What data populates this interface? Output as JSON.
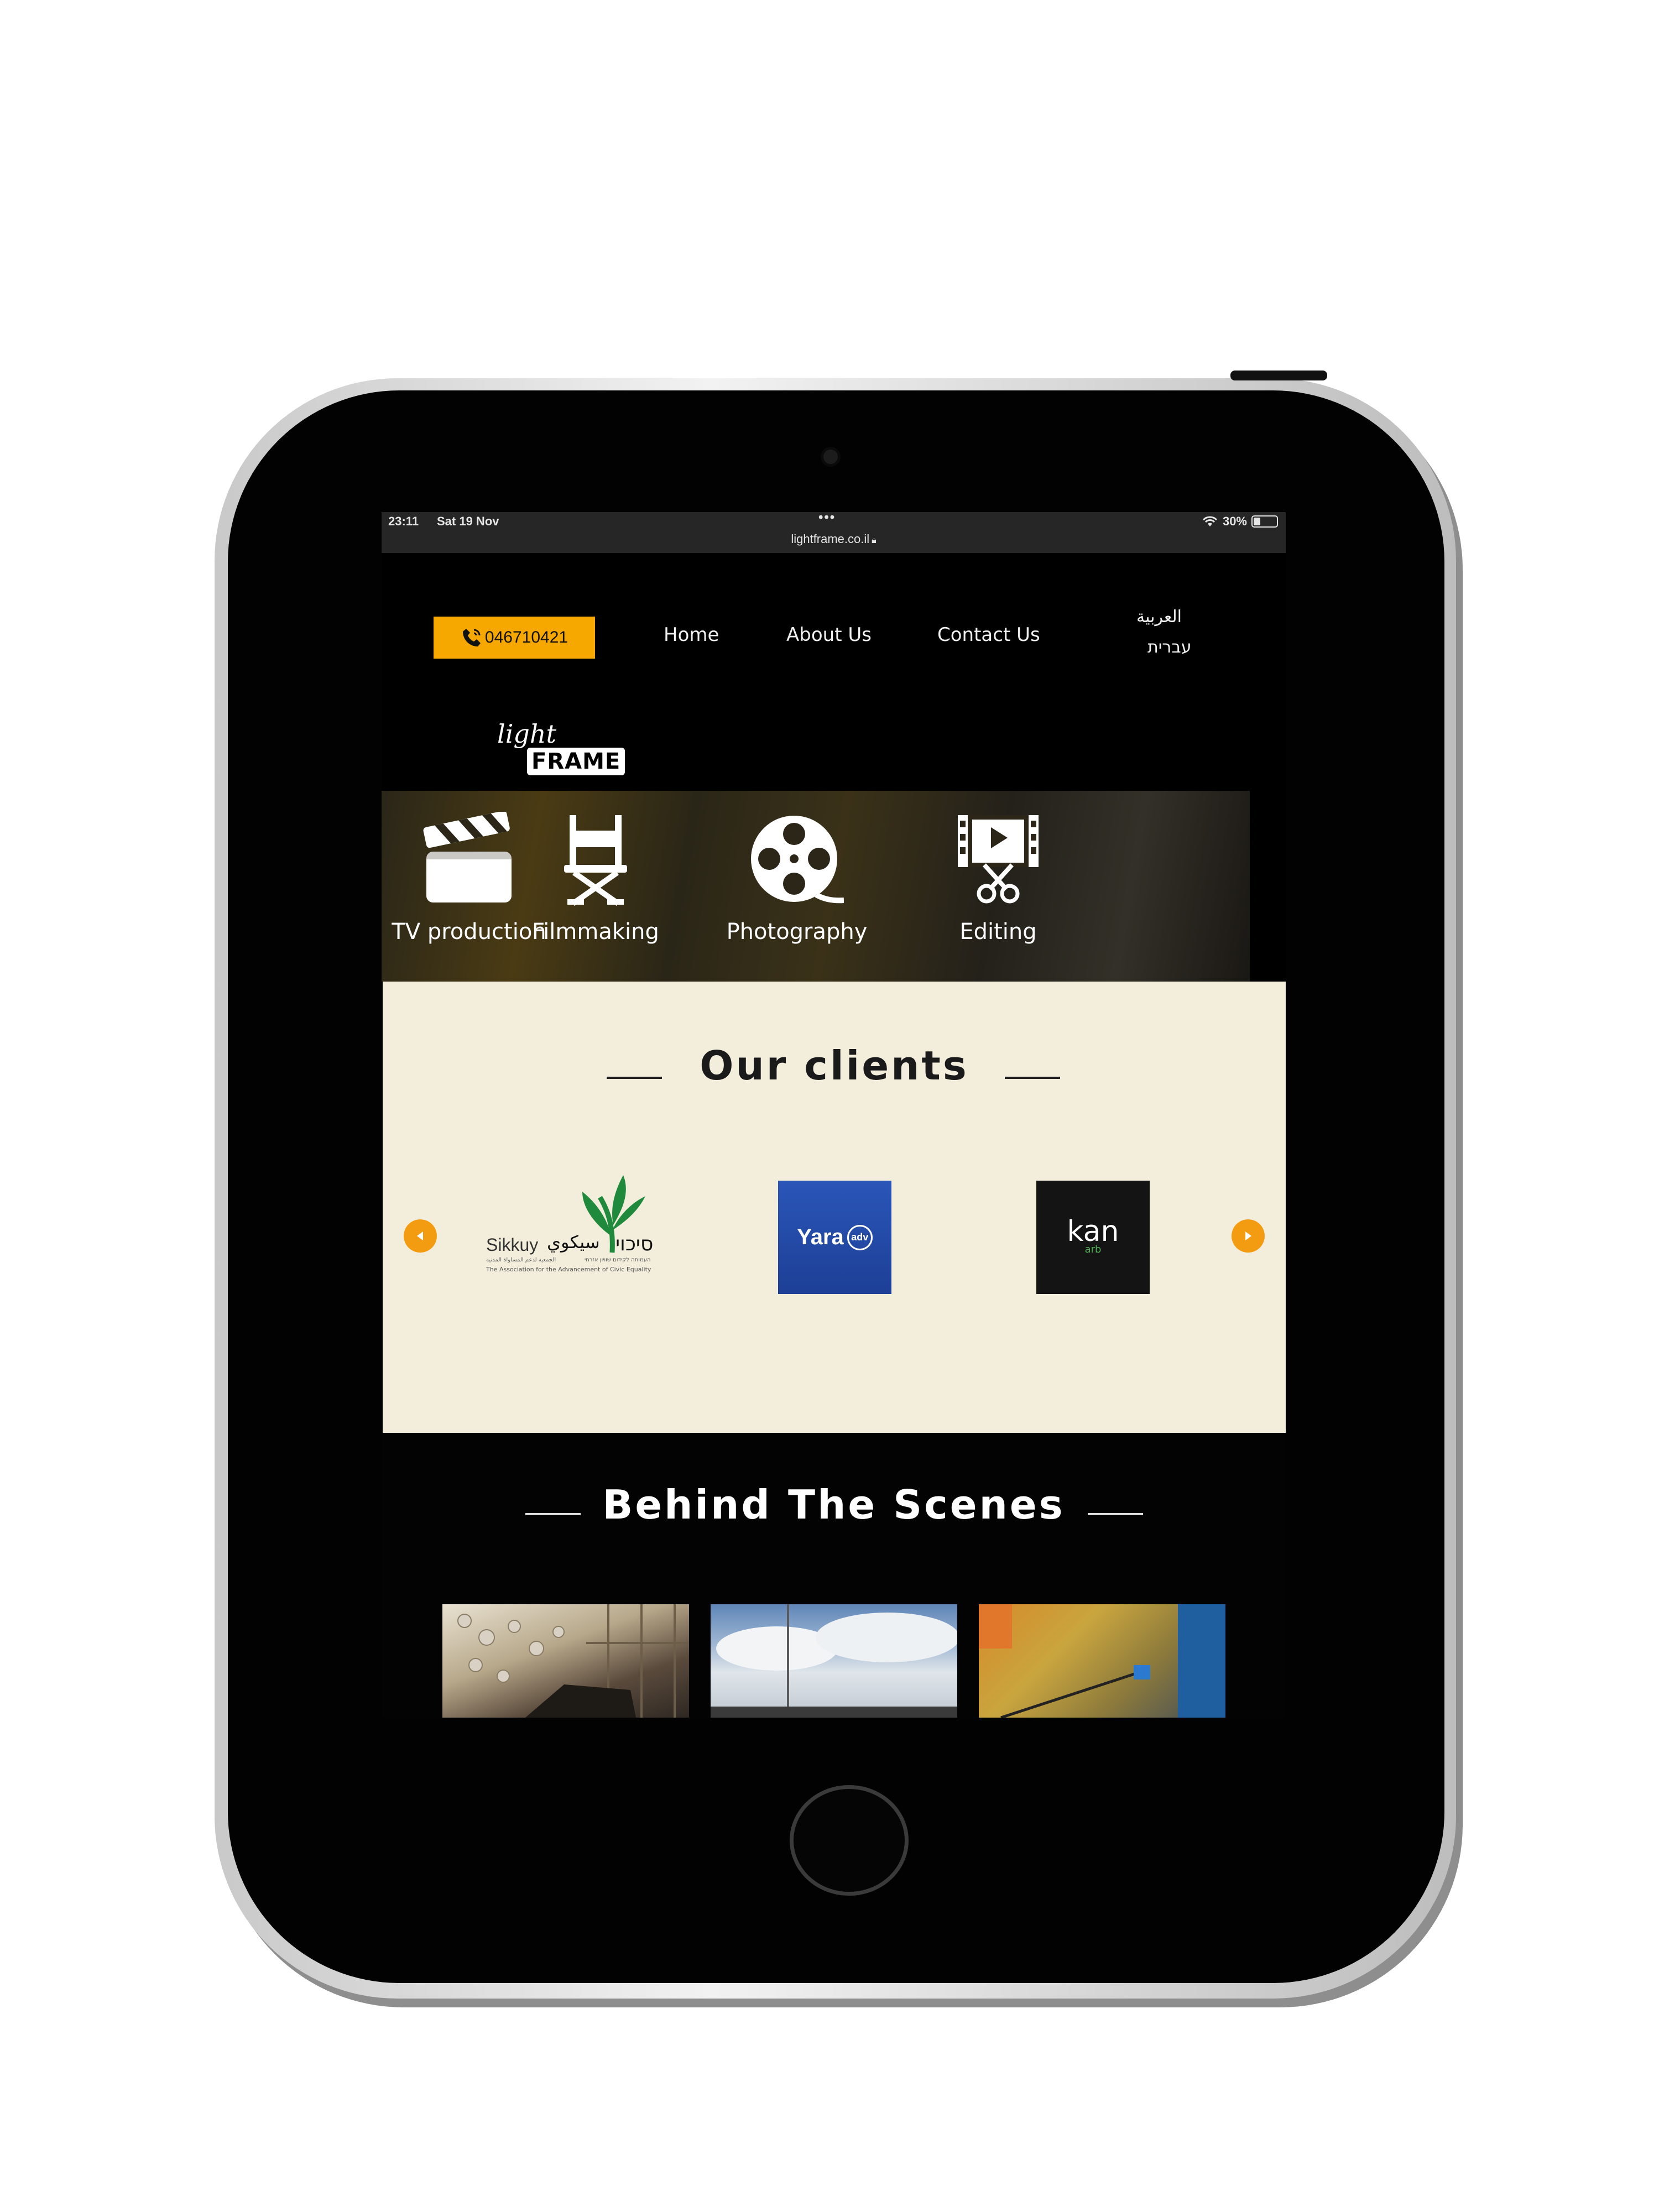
{
  "status_bar": {
    "time": "23:11",
    "date": "Sat 19 Nov",
    "dots": "•••",
    "url": "lightframe.co.il",
    "battery": "30%"
  },
  "nav": {
    "phone": "046710421",
    "links": [
      "Home",
      "About Us",
      "Contact Us"
    ],
    "languages": [
      "العربية",
      "עברית"
    ]
  },
  "logo": {
    "light": "light",
    "frame": "FRAME"
  },
  "services": [
    {
      "label": "TV production",
      "icon": "clapperboard-icon"
    },
    {
      "label": "Filmmaking",
      "icon": "director-chair-icon"
    },
    {
      "label": "Photography",
      "icon": "film-reel-icon"
    },
    {
      "label": "Editing",
      "icon": "film-scissors-icon"
    }
  ],
  "clients": {
    "title": "Our clients",
    "logos": [
      {
        "name": "Sikkuy",
        "text": "Sikkuy",
        "arabic": "سيكوي",
        "hebrew": "סיכוי",
        "sub_hebrew": "העמותה לקידום שוויון אזרחי",
        "sub_arabic": "الجمعية لدعم المساواة المدنية",
        "sub_english": "The Association for the Advancement of Civic Equality"
      },
      {
        "name": "Yara",
        "text": "Yara",
        "badge": "adv"
      },
      {
        "name": "kan",
        "text": "kan",
        "sub": "arb"
      }
    ]
  },
  "behind_the_scenes": {
    "title": "Behind The Scenes"
  },
  "colors": {
    "accent": "#f6a700",
    "arrow": "#f39c12",
    "clients_bg": "#f3eedb",
    "page_bg": "#000000"
  }
}
